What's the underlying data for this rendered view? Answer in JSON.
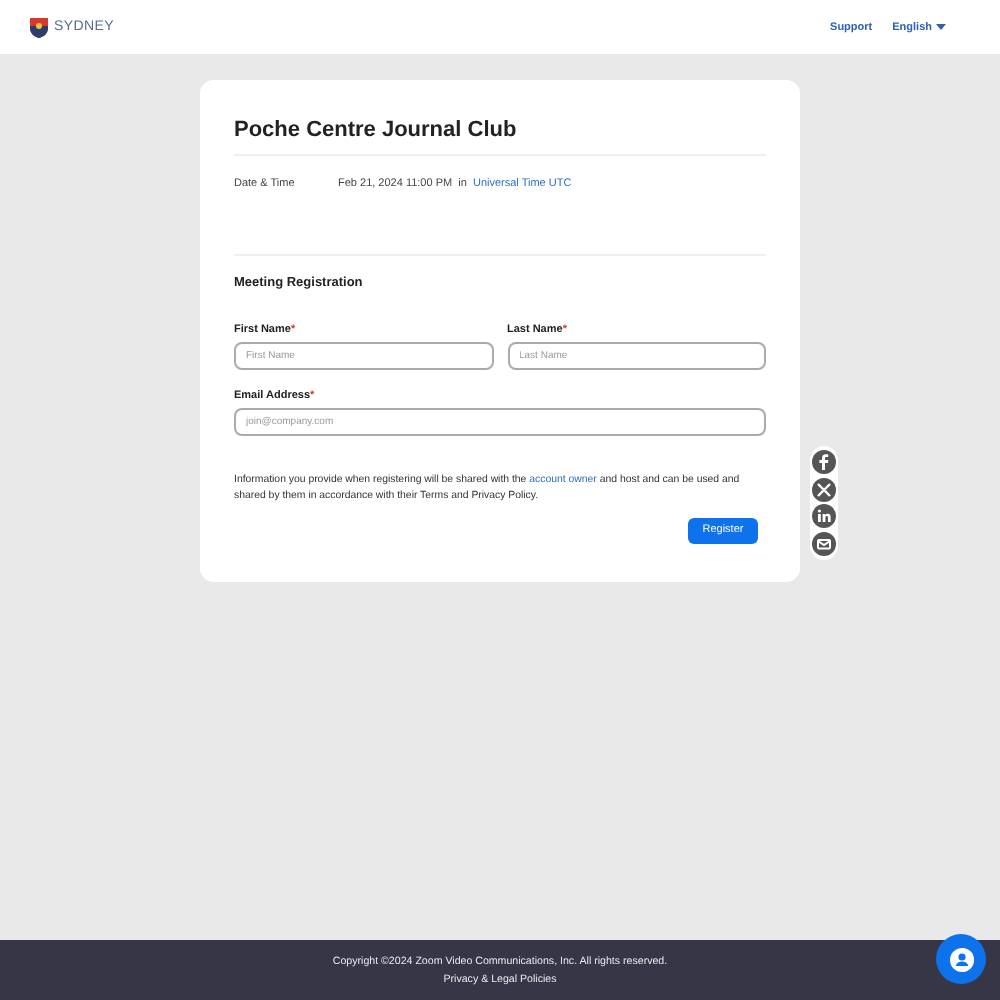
{
  "header": {
    "logo_text": "SYDNEY",
    "links": [
      {
        "label": "Support"
      },
      {
        "label": "English",
        "has_caret": true
      }
    ]
  },
  "meeting": {
    "title": "Poche Centre Journal Club",
    "date_label": "Date & Time",
    "date_value": "Feb 21, 2024 11:00 PM",
    "date_in": "in",
    "timezone": "Universal Time UTC"
  },
  "registration": {
    "heading": "Meeting Registration",
    "fields": [
      {
        "label": "First Name",
        "required_mark": "*",
        "placeholder": "First Name",
        "kind": "half"
      },
      {
        "label": "Last Name",
        "required_mark": "*",
        "placeholder": "Last Name",
        "kind": "half"
      },
      {
        "label": "Email Address",
        "required_mark": "*",
        "placeholder": "join@company.com",
        "kind": "full"
      }
    ],
    "notice_before": "Information you provide when registering will be shared with the",
    "notice_link": "account owner",
    "notice_after": "and host and can be used and shared by them in accordance with their Terms and Privacy Policy.",
    "button": "Register"
  },
  "share": [
    {
      "kind": "facebook"
    },
    {
      "kind": "x"
    },
    {
      "kind": "linkedin"
    },
    {
      "kind": "email"
    }
  ],
  "footer": {
    "copyright": "Copyright ©2024 Zoom Video Communications, Inc. All rights reserved.",
    "link": "Privacy & Legal Policies"
  }
}
